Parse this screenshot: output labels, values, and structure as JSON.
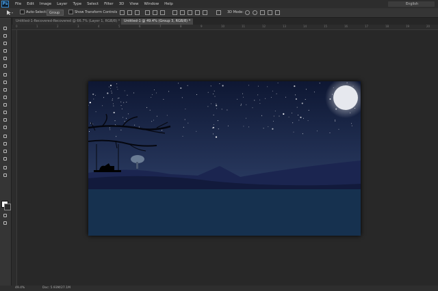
{
  "app": {
    "logo": "Ps"
  },
  "menu": [
    "File",
    "Edit",
    "Image",
    "Layer",
    "Type",
    "Select",
    "Filter",
    "3D",
    "View",
    "Window",
    "Help"
  ],
  "language": "English",
  "options": {
    "auto_select_label": "Auto-Select:",
    "auto_select_value": "Group",
    "show_transform_label": "Show Transform Controls",
    "mode_3d_label": "3D Mode:"
  },
  "tabs": [
    {
      "label": "Untitled-1-Recovered-Recovered @ 66.7% (Layer 1, RGB/8) *",
      "active": false
    },
    {
      "label": "Untitled-1 @ 49.4% (Group 3, RGB/8) *",
      "active": true
    }
  ],
  "ruler_marks": [
    "0",
    "1",
    "2",
    "3",
    "4",
    "5",
    "6",
    "7",
    "8",
    "9",
    "10",
    "11",
    "12",
    "13",
    "14",
    "15",
    "16",
    "17",
    "18",
    "19",
    "20"
  ],
  "status": {
    "zoom": "49.4%",
    "doc": "Doc: 5.93M/27.1M"
  },
  "colors": {
    "sky_top": "#0f1a38",
    "sky_bottom": "#2a3a60",
    "water": "#16314f",
    "moon": "#e6e8ee"
  }
}
